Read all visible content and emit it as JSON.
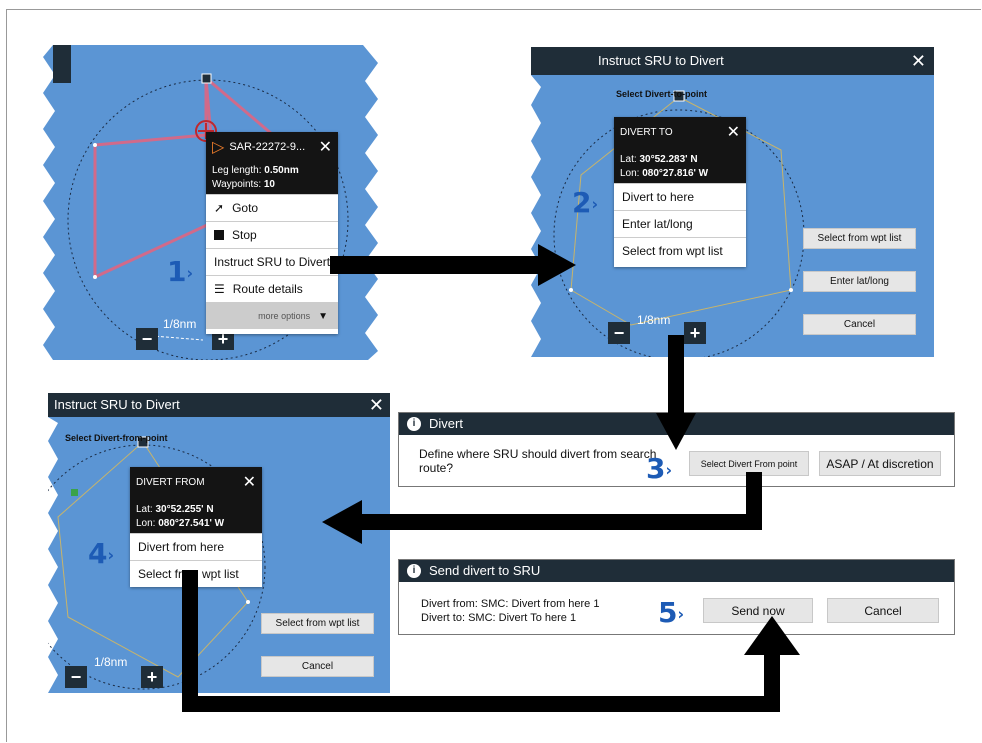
{
  "panel1": {
    "route_name": "SAR-22272-9...",
    "leg_label": "Leg length:",
    "leg_value": "0.50nm",
    "wpt_label": "Waypoints:",
    "wpt_value": "10",
    "items": [
      "Goto",
      "Stop",
      "Instruct SRU to Divert",
      "Route details"
    ],
    "more_options": "more options",
    "scale": "1/8nm"
  },
  "panel2": {
    "title": "Instruct SRU to Divert",
    "select_label": "Select Divert-to-point",
    "menu_title": "DIVERT TO",
    "lat_label": "Lat:",
    "lat": "30°52.283' N",
    "lon_label": "Lon:",
    "lon": "080°27.816' W",
    "items": [
      "Divert to here",
      "Enter lat/long",
      "Select from wpt list"
    ],
    "buttons": [
      "Select from wpt list",
      "Enter lat/long",
      "Cancel"
    ],
    "scale": "1/8nm"
  },
  "panel3": {
    "title": "Instruct SRU to Divert",
    "select_label": "Select Divert-from-point",
    "menu_title": "DIVERT FROM",
    "lat_label": "Lat:",
    "lat": "30°52.255' N",
    "lon_label": "Lon:",
    "lon": "080°27.541' W",
    "items": [
      "Divert from here",
      "Select from wpt list"
    ],
    "buttons": [
      "Select from wpt list",
      "Cancel"
    ],
    "scale": "1/8nm"
  },
  "dialog_divert": {
    "title": "Divert",
    "text": "Define where SRU should divert from search route?",
    "buttons": [
      "Select Divert From point",
      "ASAP / At discretion"
    ]
  },
  "dialog_send": {
    "title": "Send divert to SRU",
    "line1": "Divert from: SMC: Divert from here 1",
    "line2": "Divert to: SMC: Divert To here 1",
    "buttons": [
      "Send now",
      "Cancel"
    ]
  },
  "steps": [
    "1",
    "2",
    "3",
    "4",
    "5"
  ],
  "colors": {
    "chart": "#5b95d4",
    "titlebar": "#1f2d38",
    "step": "#1d5bb5",
    "route": "#d16a8a"
  }
}
